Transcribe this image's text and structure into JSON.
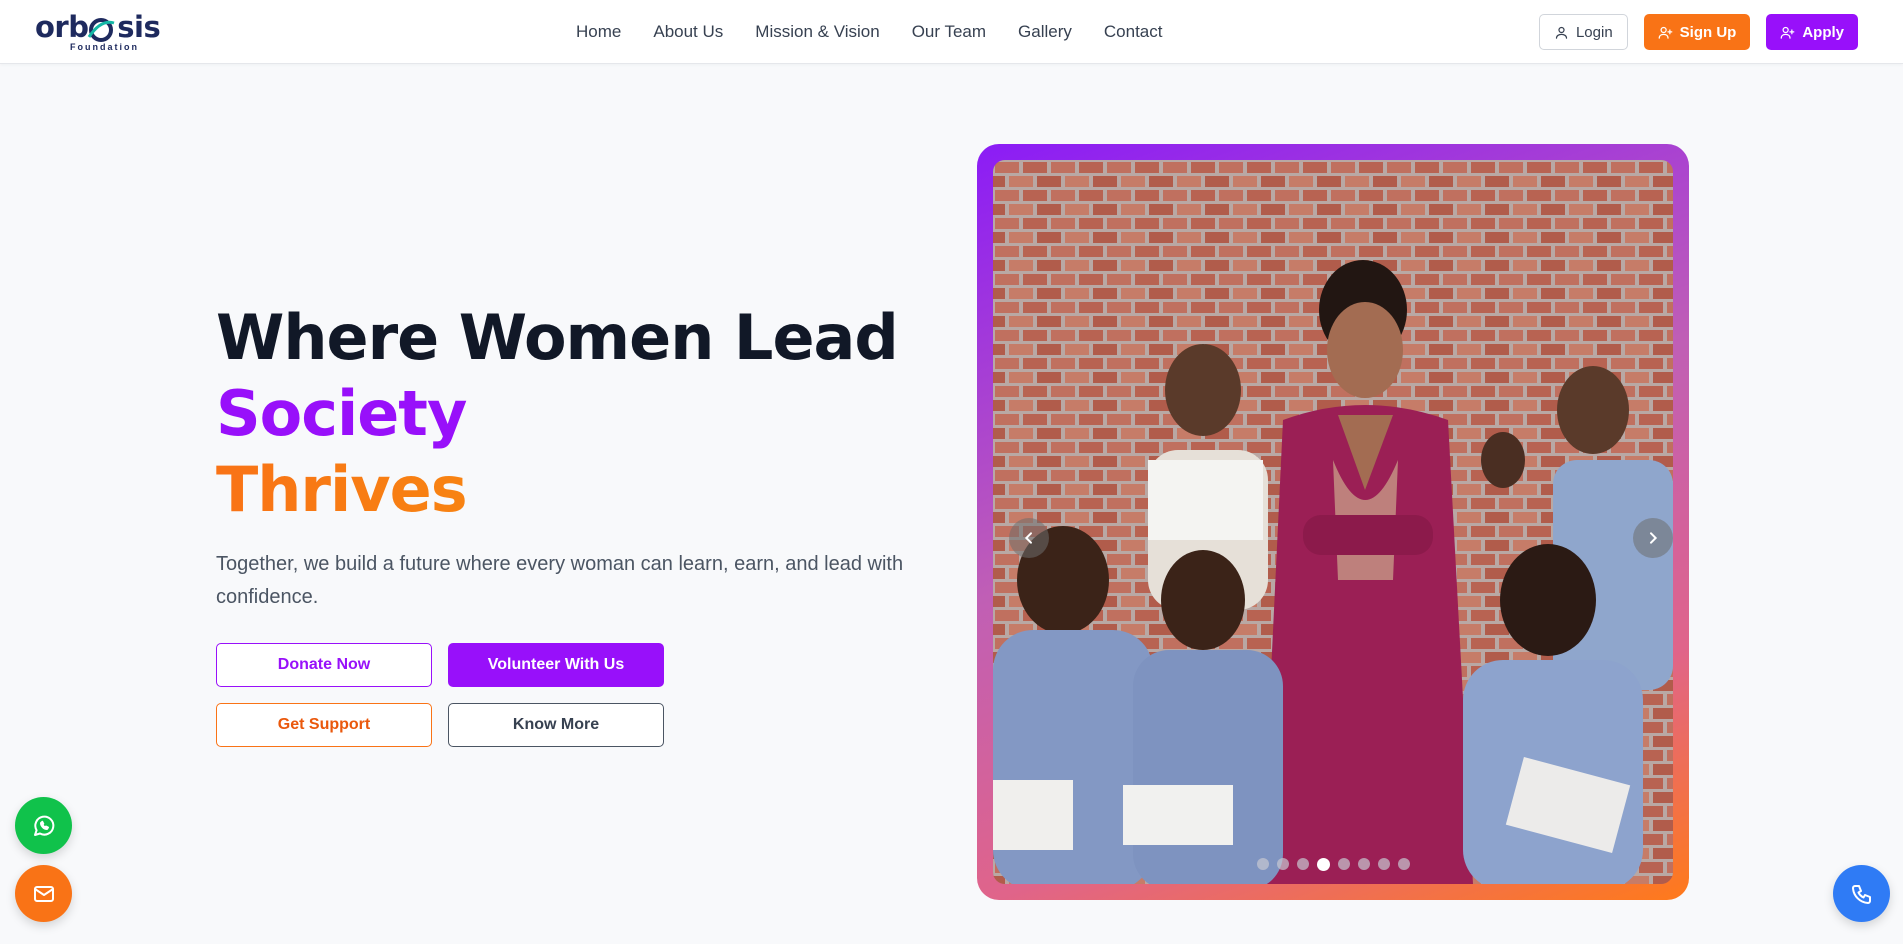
{
  "brand": {
    "name": "orbosis",
    "subtitle": "Foundation"
  },
  "nav": {
    "items": [
      "Home",
      "About Us",
      "Mission & Vision",
      "Our Team",
      "Gallery",
      "Contact"
    ]
  },
  "auth": {
    "login_label": "Login",
    "signup_label": "Sign Up",
    "apply_label": "Apply"
  },
  "hero": {
    "title_line1": "Where Women Lead",
    "title_line2": "Society",
    "title_line3": "Thrives",
    "subtitle": "Together, we build a future where every woman can learn, earn, and lead with confidence.",
    "cta": {
      "donate": "Donate Now",
      "volunteer": "Volunteer With Us",
      "support": "Get Support",
      "know_more": "Know More"
    }
  },
  "carousel": {
    "slide_count": 8,
    "active_index": 3
  },
  "colors": {
    "purple": "#9810fa",
    "orange": "#f97316",
    "amber": "#f59e0b",
    "whatsapp": "#10c24b",
    "phone": "#2f7bf5"
  },
  "icons": {
    "login": "user-icon",
    "signup": "user-plus-icon",
    "apply": "user-plus-icon",
    "prev": "chevron-left-icon",
    "next": "chevron-right-icon",
    "whatsapp": "whatsapp-icon",
    "mail": "mail-icon",
    "phone": "phone-icon"
  }
}
